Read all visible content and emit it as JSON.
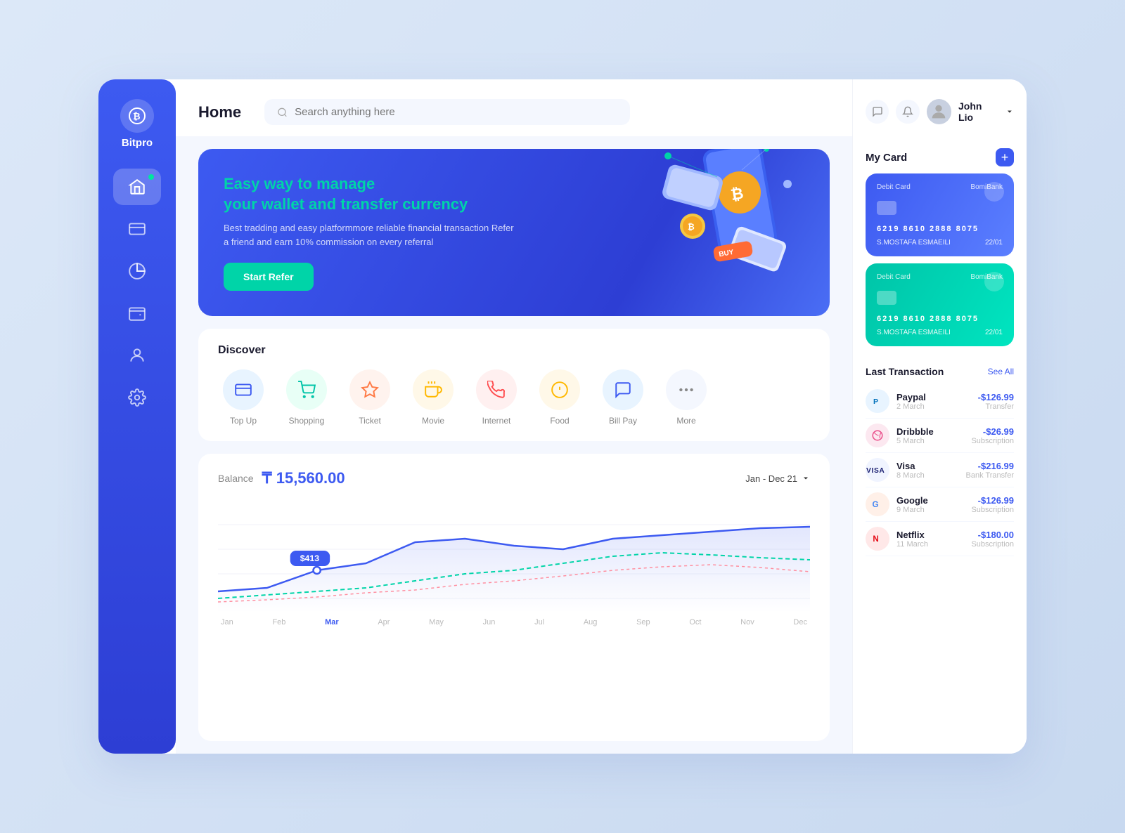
{
  "app": {
    "name": "Bitpro",
    "logo_symbol": "₿"
  },
  "sidebar": {
    "items": [
      {
        "id": "home",
        "icon": "home",
        "active": true,
        "badge": true
      },
      {
        "id": "cards",
        "icon": "card",
        "active": false,
        "badge": false
      },
      {
        "id": "analytics",
        "icon": "pie",
        "active": false,
        "badge": false
      },
      {
        "id": "wallet",
        "icon": "wallet",
        "active": false,
        "badge": false
      },
      {
        "id": "profile",
        "icon": "user",
        "active": false,
        "badge": false
      },
      {
        "id": "settings",
        "icon": "gear",
        "active": false,
        "badge": false
      }
    ]
  },
  "header": {
    "title": "Home",
    "search_placeholder": "Search anything here",
    "user_name": "John Lio"
  },
  "hero": {
    "subtitle": "Easy way to",
    "highlight": "manage",
    "title2": "your wallet and transfer currency",
    "description": "Best tradding and easy platformmore reliable financial transaction\nRefer a friend and earn 10% commission on every referral",
    "button_label": "Start Refer"
  },
  "discover": {
    "title": "Discover",
    "items": [
      {
        "id": "topup",
        "label": "Top Up",
        "icon": "💳",
        "bg": "#e8f4ff",
        "color": "#3d5af1"
      },
      {
        "id": "shopping",
        "label": "Shopping",
        "icon": "🛍️",
        "bg": "#e8fff6",
        "color": "#00c4a8"
      },
      {
        "id": "ticket",
        "label": "Ticket",
        "icon": "⭐",
        "bg": "#fff3ee",
        "color": "#ff7a45"
      },
      {
        "id": "movie",
        "label": "Movie",
        "icon": "☕",
        "bg": "#fff8e8",
        "color": "#ffb800"
      },
      {
        "id": "internet",
        "label": "Internet",
        "icon": "📞",
        "bg": "#fff0f0",
        "color": "#ff4d4f"
      },
      {
        "id": "food",
        "label": "Food",
        "icon": "🍳",
        "bg": "#fff8e8",
        "color": "#ffb800"
      },
      {
        "id": "billpay",
        "label": "Bill Pay",
        "icon": "💬",
        "bg": "#e8f4ff",
        "color": "#3d5af1"
      },
      {
        "id": "more",
        "label": "More",
        "icon": "•••",
        "bg": "#f4f7fe",
        "color": "#888"
      }
    ]
  },
  "balance": {
    "label": "Balance",
    "currency_symbol": "₸",
    "value": "15,560.00",
    "date_range": "Jan - Dec 21",
    "chart_label": "$413",
    "months": [
      "Jan",
      "Feb",
      "Mar",
      "Apr",
      "May",
      "Jun",
      "Jul",
      "Aug",
      "Sep",
      "Oct",
      "Nov",
      "Dec"
    ],
    "active_month": "Mar"
  },
  "my_card": {
    "title": "My Card",
    "cards": [
      {
        "type": "Debit Card",
        "bank": "BomiBank",
        "number": "6219   8610   2888   8075",
        "holder": "S.MOSTAFA ESMAEILI",
        "expiry": "22/01",
        "style": "blue"
      },
      {
        "type": "Debit Card",
        "bank": "BomiBank",
        "number": "6219   8610   2888   8075",
        "holder": "S.MOSTAFA ESMAEILI",
        "expiry": "22/01",
        "style": "teal"
      }
    ]
  },
  "transactions": {
    "title": "Last Transaction",
    "see_all": "See All",
    "items": [
      {
        "name": "Paypal",
        "date": "2 March",
        "amount": "-$126.99",
        "type": "Transfer",
        "bg": "#e8f4ff",
        "color": "#0070ba",
        "symbol": "P"
      },
      {
        "name": "Dribbble",
        "date": "5 March",
        "amount": "-$26.99",
        "type": "Subscription",
        "bg": "#fce8f0",
        "color": "#ea4c89",
        "symbol": "D"
      },
      {
        "name": "Visa",
        "date": "8 March",
        "amount": "-$216.99",
        "type": "Bank Transfer",
        "bg": "#f0f4ff",
        "color": "#1a1f71",
        "symbol": "V"
      },
      {
        "name": "Google",
        "date": "9 March",
        "amount": "-$126.99",
        "type": "Subscription",
        "bg": "#fff0e8",
        "color": "#4285f4",
        "symbol": "G"
      },
      {
        "name": "Netflix",
        "date": "11 March",
        "amount": "-$180.00",
        "type": "Subscription",
        "bg": "#ffe8e8",
        "color": "#e50914",
        "symbol": "N"
      }
    ]
  }
}
